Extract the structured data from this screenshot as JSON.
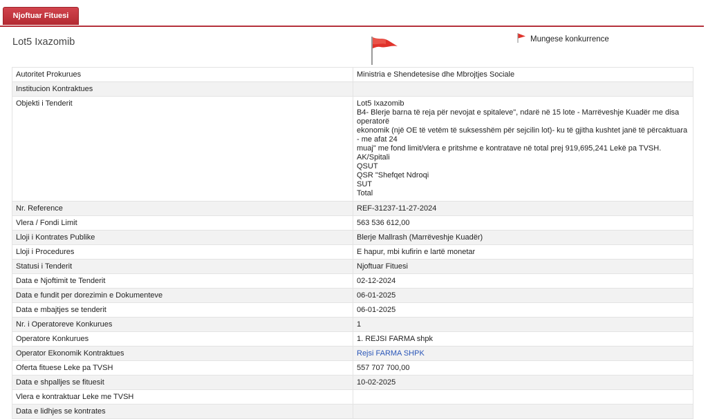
{
  "tab": {
    "label": "Njoftuar Fituesi"
  },
  "title": "Lot5 Ixazomib",
  "legend": {
    "label": "Mungese konkurrence"
  },
  "colors": {
    "accent": "#b5313a",
    "flag": "#e0332b",
    "link": "#2a56b8"
  },
  "rows": [
    {
      "key": "Autoritet Prokurues",
      "value": "Ministria e Shendetesise dhe Mbrojtjes Sociale"
    },
    {
      "key": "Institucion Kontraktues",
      "value": ""
    },
    {
      "key": "Objekti i Tenderit",
      "lines": [
        "Lot5 Ixazomib",
        "B4- Blerje barna të reja për nevojat e spitaleve\", ndarë në 15 lote - Marrëveshje Kuadër me disa operatorë",
        "ekonomik (një OE të vetëm të suksesshëm për sejcilin lot)- ku të gjitha kushtet janë të përcaktuara - me afat 24",
        "muaj\" me fond limit/vlera e pritshme e kontratave në total prej 919,695,241 Lekë pa TVSH.",
        "AK/Spitali",
        "QSUT",
        "QSR \"Shefqet Ndroqi",
        "SUT",
        "Total"
      ]
    },
    {
      "key": "Nr. Reference",
      "value": "REF-31237-11-27-2024"
    },
    {
      "key": "Vlera / Fondi Limit",
      "value": "563 536 612,00"
    },
    {
      "key": "Lloji i Kontrates Publike",
      "value": "Blerje Mallrash (Marrëveshje Kuadër)"
    },
    {
      "key": "Lloji i Procedures",
      "value": "E hapur, mbi kufirin e lartë monetar"
    },
    {
      "key": "Statusi i Tenderit",
      "value": "Njoftuar Fituesi"
    },
    {
      "key": "Data e Njoftimit te Tenderit",
      "value": "02-12-2024"
    },
    {
      "key": "Data e fundit per dorezimin e Dokumenteve",
      "value": "06-01-2025"
    },
    {
      "key": "Data e mbajtjes se tenderit",
      "value": "06-01-2025"
    },
    {
      "key": "Nr. i Operatoreve Konkurues",
      "value": "1"
    },
    {
      "key": "Operatore Konkurues",
      "value": "1. REJSI FARMA shpk"
    },
    {
      "key": "Operator Ekonomik Kontraktues",
      "value": "Rejsi FARMA SHPK",
      "link": true
    },
    {
      "key": "Oferta fituese Leke pa TVSH",
      "value": "557 707 700,00"
    },
    {
      "key": "Data e shpalljes se fituesit",
      "value": "10-02-2025"
    },
    {
      "key": "Vlera e kontraktuar Leke me TVSH",
      "value": ""
    },
    {
      "key": "Data e lidhjes se kontrates",
      "value": ""
    }
  ]
}
